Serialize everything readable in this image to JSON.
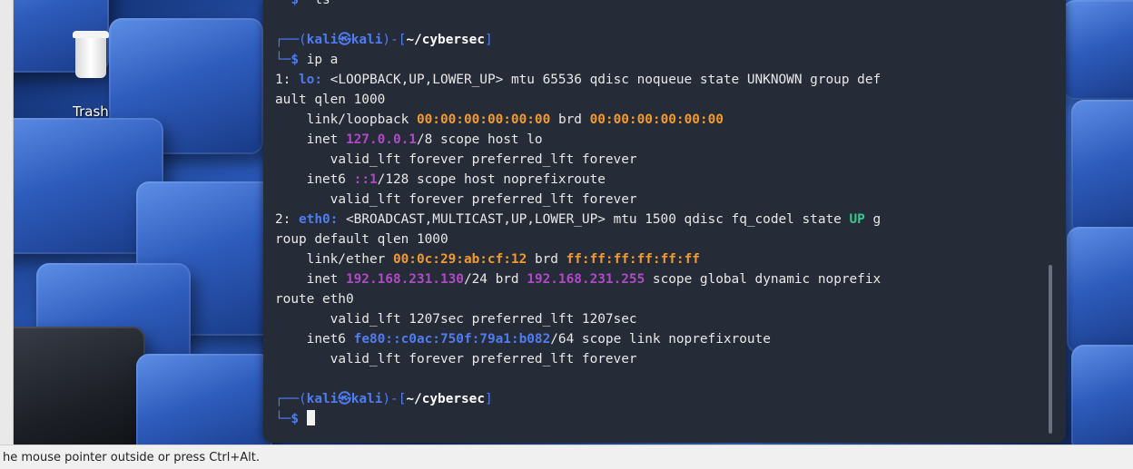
{
  "desktop": {
    "trash_label": "Trash"
  },
  "terminal": {
    "top_line": "  ls",
    "prompt1": {
      "user": "kali",
      "at_icon": "㉿",
      "host": "kali",
      "cwd": "~/cybersec",
      "command": "ip a"
    },
    "prompt2": {
      "user": "kali",
      "at_icon": "㉿",
      "host": "kali",
      "cwd": "~/cybersec"
    },
    "lo": {
      "index": "1:",
      "name": "lo:",
      "flags_wrap1": "<LOOPBACK,UP,LOWER_UP> mtu 65536 qdisc noqueue state UNKNOWN group def",
      "flags_wrap2": "ault qlen 1000",
      "link_type": "link/loopback",
      "mac": "00:00:00:00:00:00",
      "brd_label": "brd",
      "brd_mac": "00:00:00:00:00:00",
      "inet_label": "inet",
      "inet_addr": "127.0.0.1",
      "inet_rest": "/8 scope host lo",
      "valid1": "valid_lft forever preferred_lft forever",
      "inet6_label": "inet6",
      "inet6_addr": "::1",
      "inet6_rest": "/128 scope host noprefixroute",
      "valid2": "valid_lft forever preferred_lft forever"
    },
    "eth0": {
      "index": "2:",
      "name": "eth0:",
      "flags_a": "<BROADCAST,MULTICAST,UP,LOWER_UP> mtu 1500 qdisc fq_codel state ",
      "state": "UP",
      "flags_b": " g",
      "flags_wrap2": "roup default qlen 1000",
      "link_type": "link/ether",
      "mac": "00:0c:29:ab:cf:12",
      "brd_label": "brd",
      "brd_mac": "ff:ff:ff:ff:ff:ff",
      "inet_label": "inet",
      "inet_addr": "192.168.231.130",
      "inet_mid": "/24 brd",
      "inet_brd": "192.168.231.255",
      "inet_rest": "scope global dynamic noprefix",
      "inet_wrap2": "route eth0",
      "valid1": "valid_lft 1207sec preferred_lft 1207sec",
      "inet6_label": "inet6",
      "inet6_addr": "fe80::c0ac:750f:79a1:b082",
      "inet6_rest": "/64 scope link noprefixroute",
      "valid2": "valid_lft forever preferred_lft forever"
    }
  },
  "status_bar": {
    "text": "he mouse pointer outside or press Ctrl+Alt."
  },
  "colors": {
    "terminal_bg": "#262b38",
    "prompt_blue": "#4f7cf0",
    "mac_orange": "#f29a2e",
    "ip_purple": "#b04ac6",
    "state_green": "#36c98a"
  }
}
